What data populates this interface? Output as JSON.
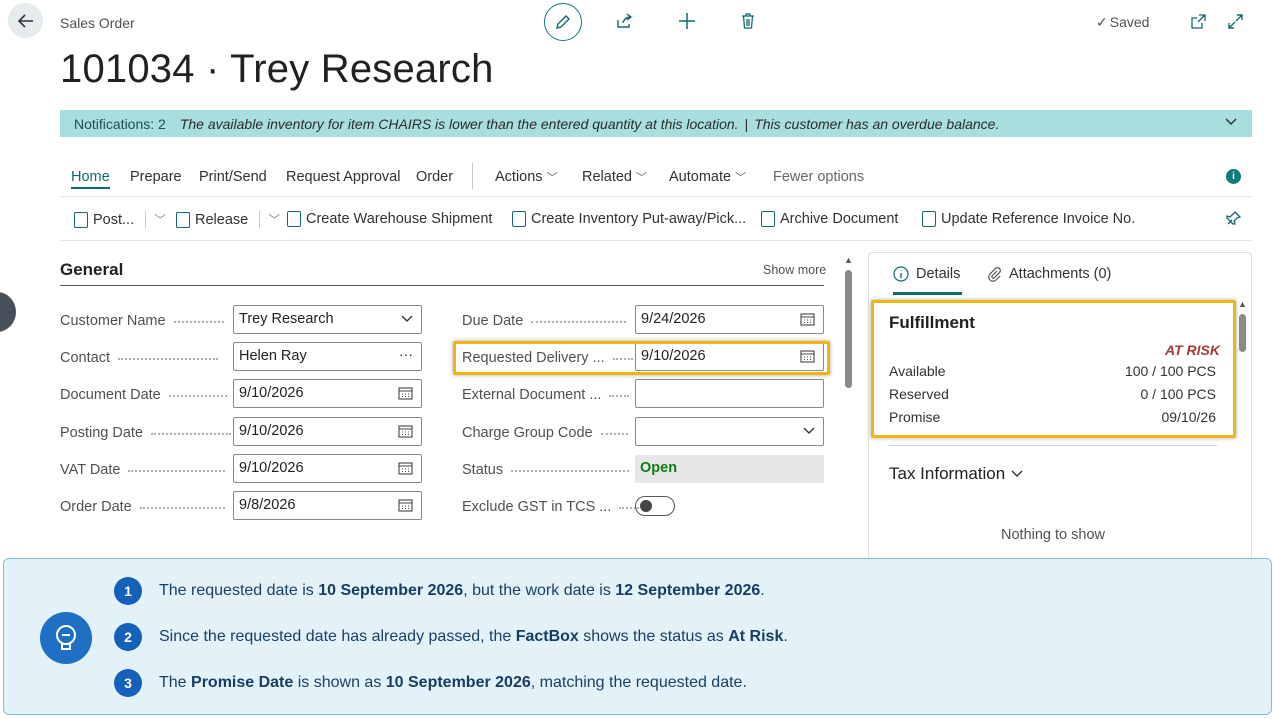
{
  "header": {
    "breadcrumb": "Sales Order",
    "title": "101034 · Trey Research",
    "saved_label": "Saved"
  },
  "notification": {
    "count_label": "Notifications: 2",
    "message1": "The available inventory for item CHAIRS is lower than the entered quantity at this location.",
    "separator": "|",
    "message2": "This customer has an overdue balance."
  },
  "tabs": {
    "home": "Home",
    "prepare": "Prepare",
    "print_send": "Print/Send",
    "request_approval": "Request Approval",
    "order": "Order",
    "actions": "Actions",
    "related": "Related",
    "automate": "Automate",
    "fewer_options": "Fewer options"
  },
  "actions": {
    "post": "Post...",
    "release": "Release",
    "create_warehouse_shipment": "Create Warehouse Shipment",
    "create_inventory_putaway": "Create Inventory Put-away/Pick...",
    "archive_document": "Archive Document",
    "update_reference_invoice": "Update Reference Invoice No."
  },
  "general": {
    "title": "General",
    "show_more": "Show more",
    "customer_name_label": "Customer Name",
    "customer_name_value": "Trey Research",
    "contact_label": "Contact",
    "contact_value": "Helen Ray",
    "document_date_label": "Document Date",
    "document_date_value": "9/10/2026",
    "posting_date_label": "Posting Date",
    "posting_date_value": "9/10/2026",
    "vat_date_label": "VAT Date",
    "vat_date_value": "9/10/2026",
    "order_date_label": "Order Date",
    "order_date_value": "9/8/2026",
    "due_date_label": "Due Date",
    "due_date_value": "9/24/2026",
    "requested_delivery_label": "Requested Delivery ...",
    "requested_delivery_value": "9/10/2026",
    "external_document_label": "External Document ...",
    "external_document_value": "",
    "charge_group_label": "Charge Group Code",
    "charge_group_value": "",
    "status_label": "Status",
    "status_value": "Open",
    "exclude_gst_label": "Exclude GST in TCS ..."
  },
  "factbox": {
    "details_tab": "Details",
    "attachments_tab": "Attachments (0)",
    "fulfillment_title": "Fulfillment",
    "status": "AT RISK",
    "available_label": "Available",
    "available_value": "100 / 100 PCS",
    "reserved_label": "Reserved",
    "reserved_value": "0 / 100 PCS",
    "promise_label": "Promise",
    "promise_value": "09/10/26",
    "tax_title": "Tax Information",
    "nothing_to_show": "Nothing to show"
  },
  "callout": {
    "items": [
      {
        "num": "1",
        "parts": [
          "The requested date is ",
          "10 September 2026",
          ", but the work date is ",
          "12 September 2026",
          "."
        ]
      },
      {
        "num": "2",
        "parts": [
          "Since the requested date has already passed, the ",
          "FactBox",
          " shows the status as ",
          "At Risk",
          "."
        ]
      },
      {
        "num": "3",
        "parts": [
          "The ",
          "Promise Date",
          " is shown as ",
          "10 September 2026",
          ", matching the requested date."
        ]
      }
    ]
  },
  "colors": {
    "accent": "#0f6b6f",
    "notification_bg": "#a9dede",
    "highlight": "#f0b415",
    "at_risk": "#a33b3b",
    "status_open": "#107c10",
    "callout_bg": "#e3f2f9",
    "callout_number": "#1560b8"
  },
  "icons": [
    "back-arrow-icon",
    "edit-pencil-icon",
    "share-icon",
    "add-icon",
    "delete-icon",
    "checkmark-icon",
    "open-new-window-icon",
    "expand-icon",
    "chevron-down-icon",
    "calendar-icon",
    "ellipsis-icon",
    "info-icon",
    "attachment-icon",
    "pin-icon",
    "lightbulb-icon"
  ]
}
